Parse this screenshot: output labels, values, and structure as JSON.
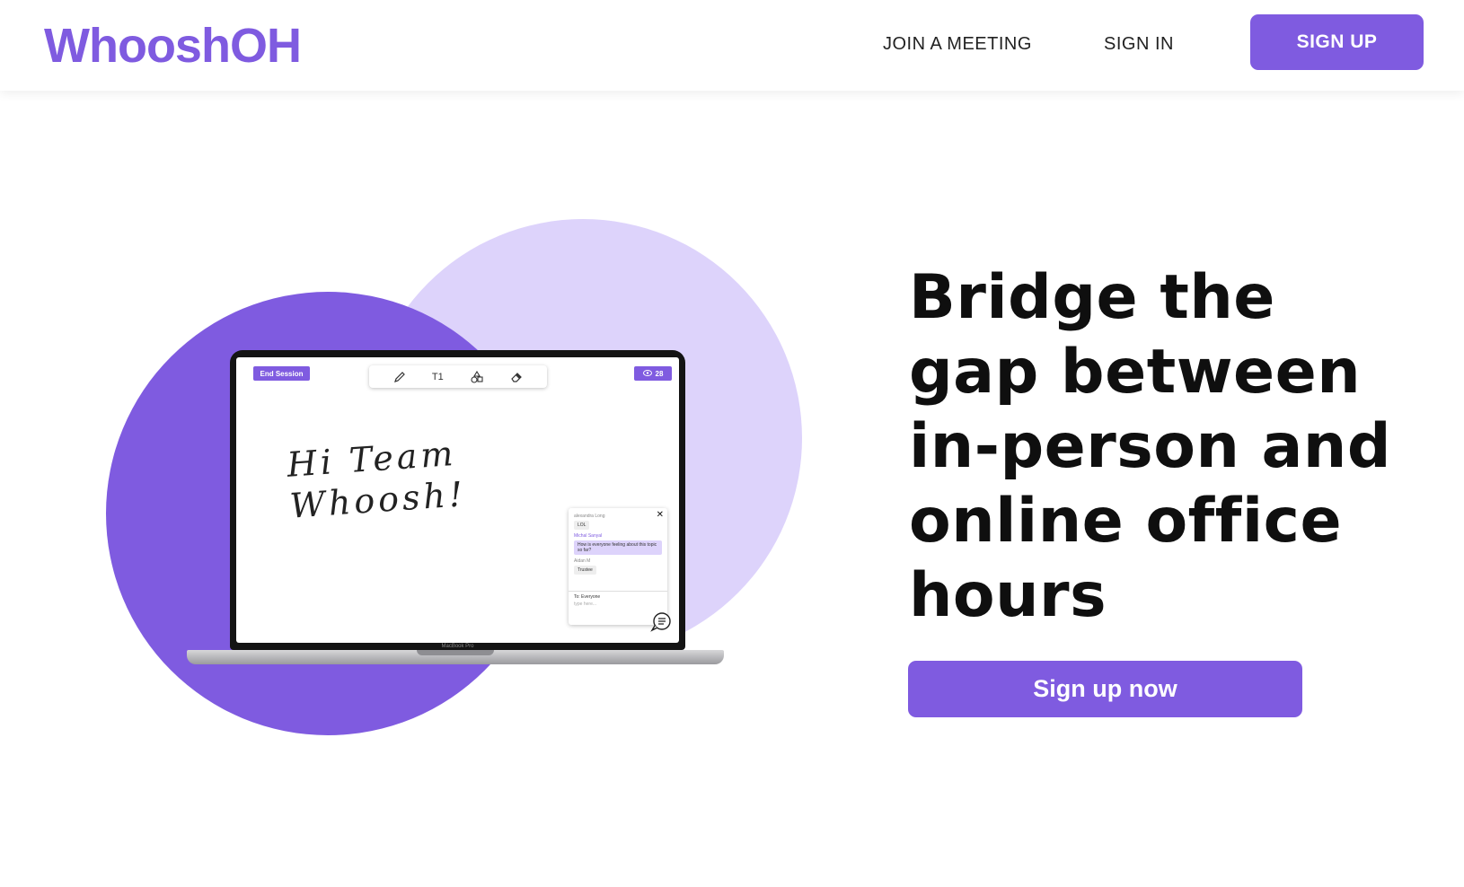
{
  "header": {
    "logo": "WhooshOH",
    "nav": {
      "join_meeting": "JOIN A MEETING",
      "sign_in": "SIGN IN",
      "sign_up": "SIGN UP"
    }
  },
  "colors": {
    "brand": "#7f5be0",
    "brand_light": "#ddd3fb",
    "text": "#0f0f0f"
  },
  "hero": {
    "title": "Bridge the gap between in-person and online office hours",
    "cta_label": "Sign up now"
  },
  "illustration": {
    "end_session": "End Session",
    "tools": [
      "pencil-icon",
      "text-icon",
      "shapes-icon",
      "eraser-icon"
    ],
    "text_tool_label": "T1",
    "viewer_count": "28",
    "handwriting_line1": "Hi Team",
    "handwriting_line2": "Whoosh!",
    "laptop_label": "MacBook Pro",
    "chat": {
      "messages": [
        {
          "name": "alexandra Long",
          "text": "LOL"
        },
        {
          "name": "Michal Sanyal",
          "text": "How is everyone feeling about this topic so far?"
        },
        {
          "name": "Aidan M",
          "text": "Trustee"
        }
      ],
      "to": "To: Everyone",
      "input_placeholder": "type here..."
    }
  }
}
